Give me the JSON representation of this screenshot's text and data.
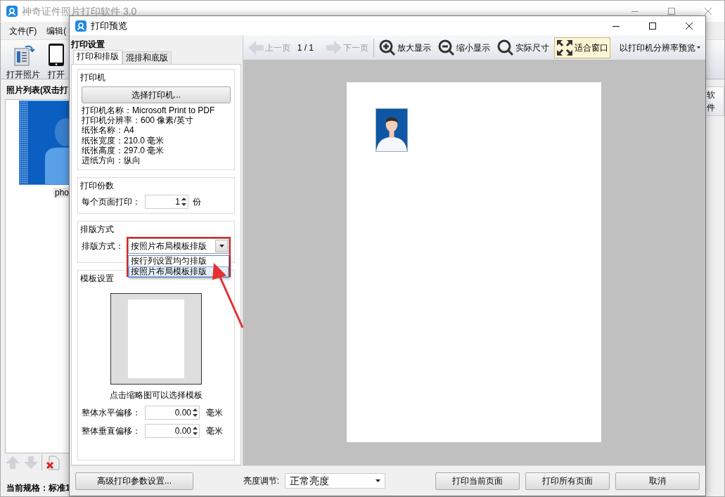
{
  "main_window": {
    "title": "神奇证件照片打印软件 3.0",
    "menu": [
      "文件(F)",
      "编辑("
    ],
    "toolbar": [
      {
        "label": "打开照片"
      },
      {
        "kind": "phone",
        "label": "打开"
      }
    ],
    "photo_list": {
      "title": "照片列表(双击打",
      "photos": [
        {
          "label": "pho",
          "selected": true
        }
      ]
    },
    "side_button": "软件",
    "status_bar": "当前规格：标准1"
  },
  "dialog": {
    "title": "打印预览",
    "settings_title": "打印设置",
    "tabs": [
      {
        "label": "打印和排版",
        "selected": true
      },
      {
        "label": "混排和底版",
        "selected": false
      }
    ],
    "printer": {
      "title": "打印机",
      "button": "选择打印机...",
      "info": [
        "打印机名称：Microsoft Print to PDF",
        "打印机分辨率：600 像素/英寸",
        "纸张名称：A4",
        "纸张宽度：210.0 毫米",
        "纸张高度：297.0 毫米",
        "进纸方向：纵向"
      ]
    },
    "copies": {
      "title": "打印份数",
      "label": "每个页面打印：",
      "value": "1",
      "unit": "份"
    },
    "layout": {
      "title": "排版方式",
      "label": "排版方式：",
      "value": "按照片布局模板排版",
      "expanded": true,
      "options": [
        {
          "label": "按行列设置均匀排版",
          "selected": false
        },
        {
          "label": "按照片布局模板排版",
          "selected": true
        }
      ]
    },
    "template": {
      "title": "模板设置",
      "caption": "点击缩略图可以选择模板",
      "offsets": [
        {
          "label": "整体水平偏移：",
          "value": "0.00",
          "unit": "毫米"
        },
        {
          "label": "整体垂直偏移：",
          "value": "0.00",
          "unit": "毫米"
        }
      ]
    },
    "advanced_button": "高级打印参数设置...",
    "toolbar": [
      {
        "kind": "prev",
        "label": "上一页",
        "disabled": true,
        "selected": false
      },
      {
        "kind": "page",
        "label": "1 / 1",
        "disabled": false,
        "selected": false
      },
      {
        "kind": "next",
        "label": "下一页",
        "disabled": true,
        "selected": false
      },
      {
        "kind": "zoom_in",
        "label": "放大显示",
        "disabled": false,
        "selected": false
      },
      {
        "kind": "zoom_out",
        "label": "缩小显示",
        "disabled": false,
        "selected": false
      },
      {
        "kind": "actual",
        "label": "实际尺寸",
        "disabled": false,
        "selected": false
      },
      {
        "kind": "fit",
        "label": "适合窗口",
        "disabled": false,
        "selected": true
      },
      {
        "kind": "menu",
        "label": "以打印机分辨率预览",
        "disabled": false,
        "selected": false
      }
    ],
    "brightness": {
      "label": "亮度调节:",
      "value": "正常亮度"
    },
    "buttons": [
      "打印当前页面",
      "打印所有页面",
      "取消"
    ]
  }
}
